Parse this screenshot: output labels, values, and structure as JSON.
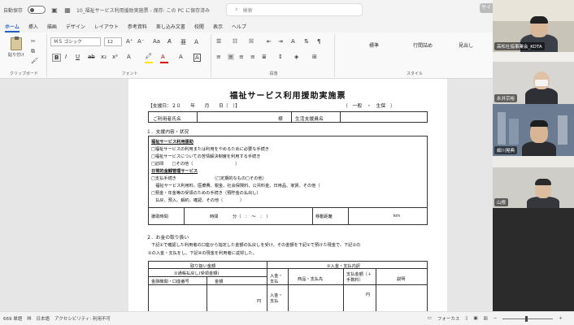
{
  "titlebar": {
    "autosave_label": "自動保存",
    "autosave_state": "オフ",
    "doc_title": "10_福祉サービス利用援助実施票 - 保存: この PC に保存済み",
    "search_placeholder": "検索",
    "corner_badge": "サイ"
  },
  "tabs": [
    "ホーム",
    "挿入",
    "描画",
    "デザイン",
    "レイアウト",
    "参考資料",
    "差し込み文書",
    "校閲",
    "表示",
    "ヘルプ"
  ],
  "ribbon": {
    "paste_label": "貼り付け",
    "clipboard_label": "クリップボード",
    "font_name": "ＭＳ ゴシック",
    "font_size": "12",
    "font_group_label": "フォント",
    "paragraph_group_label": "段落",
    "styles_group_label": "スタイル",
    "styles": [
      "標準",
      "行間詰め",
      "見出し"
    ]
  },
  "document": {
    "title": "福祉サービス利用援助実施票",
    "support_date": "【支援日：２０　　年　　月　　日（　）】",
    "type_options": "（　一般　・　生保　）",
    "user_name_label": "ご利用者氏名",
    "sama": "様",
    "specialist_label": "生活支援員名",
    "sec1": "１．支援内容・状況",
    "welfare_heading": "福祉サービス利用援助",
    "welfare_1": "□福祉サービスの利用または利用をやめるために必要な手続き",
    "welfare_2": "□福祉サービスについての苦情解決制度を利用する手続き",
    "welfare_3": "□訪問　　□その他（　　　　　　　　　　）",
    "daily_heading": "日常的金銭管理サービス",
    "daily_1": "□支払手続き　　　　　　　　　（□定期的なもの□その他）",
    "daily_2": "　福祉サービス利用料、医療費、税金、社会保険料、公共料金、日用品、家賃、その他（",
    "daily_3": "□預金・年金等の受領のための手続き（預貯金の払出し）",
    "daily_4": "　払戻、預入、解約、確認、その他（　　　　）",
    "time_label": "援助時間",
    "time_unit": "時間",
    "min_unit": "分（　：　～　：　）",
    "distance_label": "移動距離",
    "km": "km",
    "sec2": "２．お金の取り扱い",
    "money_text_1": "下記①で確認した利用者の口座から指定した金額の払戻しを受け、その金額を下記②で預けた現金で、下記②の",
    "money_text_2": "①の入金・支払をし、下記④の現金を利用者に返却した。",
    "handling_header": "取り扱い金額",
    "withdrawal_header": "①通帳払戻し(受領金額)",
    "account_header": "金融機関・口座番号",
    "amount_header": "金額",
    "entry_header": "②入金・支払内訳",
    "entry_col": "入金・支払",
    "goods_col": "商品・支払先",
    "payment_col": "支払金額（＋手数料）",
    "note_col": "説明",
    "yen": "円"
  },
  "status": {
    "page_info": "669 単語",
    "language": "日本語",
    "accessibility": "アクセシビリティ: 利用不可",
    "focus": "フォーカス"
  },
  "participants": [
    {
      "name": "高松社協事業会_KOTA"
    },
    {
      "name": "永井宗裕"
    },
    {
      "name": "細川晃典"
    },
    {
      "name": "山根"
    }
  ]
}
